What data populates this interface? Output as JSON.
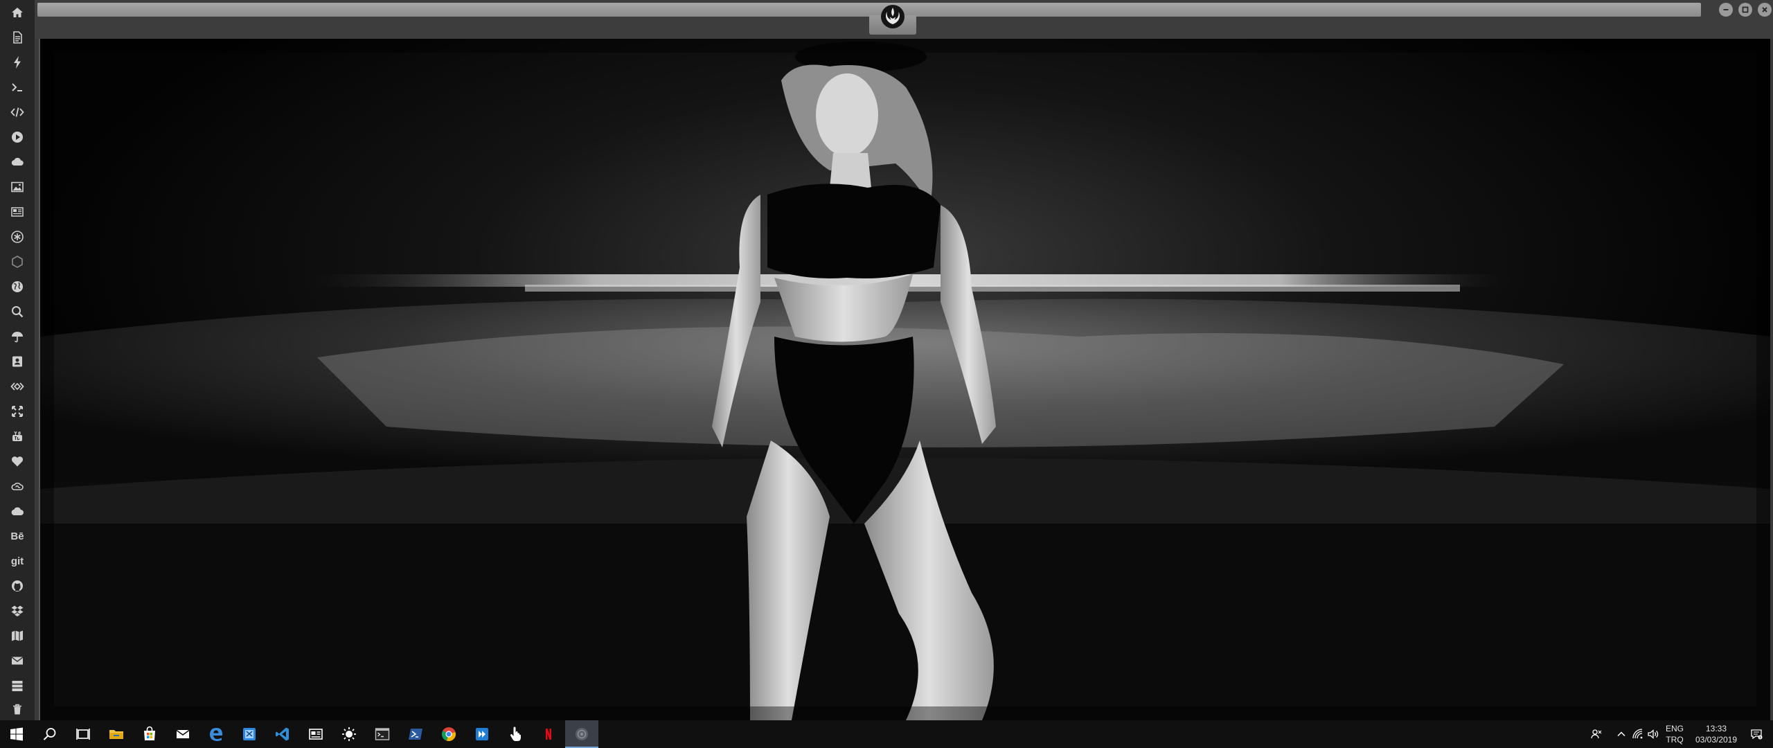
{
  "sidebar": {
    "items": [
      {
        "icon": "home-icon"
      },
      {
        "icon": "document-icon"
      },
      {
        "icon": "lightning-icon"
      },
      {
        "icon": "terminal-icon"
      },
      {
        "icon": "code-icon"
      },
      {
        "icon": "play-circle-icon"
      },
      {
        "icon": "cloud-icon"
      },
      {
        "icon": "image-icon"
      },
      {
        "icon": "newspaper-icon"
      },
      {
        "icon": "asterisk-badge-icon"
      },
      {
        "icon": "hexagon-icon"
      },
      {
        "icon": "globe-icon"
      },
      {
        "icon": "search-icon"
      },
      {
        "icon": "umbrella-icon"
      },
      {
        "icon": "contact-card-icon"
      },
      {
        "icon": "diamond-arrows-icon"
      },
      {
        "icon": "expand-icon"
      },
      {
        "icon": "youtube-icon"
      },
      {
        "icon": "heart-icon"
      },
      {
        "icon": "creative-cloud-icon"
      },
      {
        "icon": "cloud-filled-icon"
      },
      {
        "icon": "behance-icon",
        "text": "Bē"
      },
      {
        "icon": "git-icon",
        "text": "git"
      },
      {
        "icon": "github-icon"
      },
      {
        "icon": "dropbox-icon"
      },
      {
        "icon": "map-icon"
      },
      {
        "icon": "mail-icon"
      },
      {
        "icon": "server-icon"
      },
      {
        "icon": "trash-icon"
      }
    ]
  },
  "window": {
    "logo_icon": "rebel-alliance-icon",
    "controls": [
      "minimize-icon",
      "maximize-icon",
      "close-icon"
    ]
  },
  "content": {
    "type": "video-frame",
    "subject": "black-and-white-photo"
  },
  "taskbar": {
    "apps": [
      {
        "name": "start",
        "icon": "windows-logo-icon"
      },
      {
        "name": "search",
        "icon": "search-icon"
      },
      {
        "name": "task-view",
        "icon": "task-view-icon"
      },
      {
        "name": "file-explorer",
        "icon": "folder-icon"
      },
      {
        "name": "store",
        "icon": "store-bag-icon"
      },
      {
        "name": "mail",
        "icon": "mail-icon"
      },
      {
        "name": "edge",
        "icon": "edge-icon"
      },
      {
        "name": "snip",
        "icon": "snipping-icon"
      },
      {
        "name": "vscode",
        "icon": "vscode-icon"
      },
      {
        "name": "news",
        "icon": "news-icon"
      },
      {
        "name": "brightness",
        "icon": "sun-icon"
      },
      {
        "name": "terminal",
        "icon": "terminal-window-icon"
      },
      {
        "name": "powershell",
        "icon": "powershell-icon"
      },
      {
        "name": "chrome",
        "icon": "chrome-icon"
      },
      {
        "name": "media-player",
        "icon": "media-player-icon"
      },
      {
        "name": "touch",
        "icon": "hand-pointer-icon"
      },
      {
        "name": "netflix",
        "icon": "netflix-icon"
      },
      {
        "name": "active-app",
        "icon": "active-app-icon",
        "active": true
      }
    ],
    "tray": {
      "language_line1": "ENG",
      "language_line2": "TRQ",
      "time": "13:33",
      "date": "03/03/2019"
    }
  },
  "colors": {
    "sidebar_bg": "#262626",
    "titlebar_bg": "#3d3d3d",
    "taskbar_bg": "#101010",
    "accent": "#7aa7d8"
  }
}
